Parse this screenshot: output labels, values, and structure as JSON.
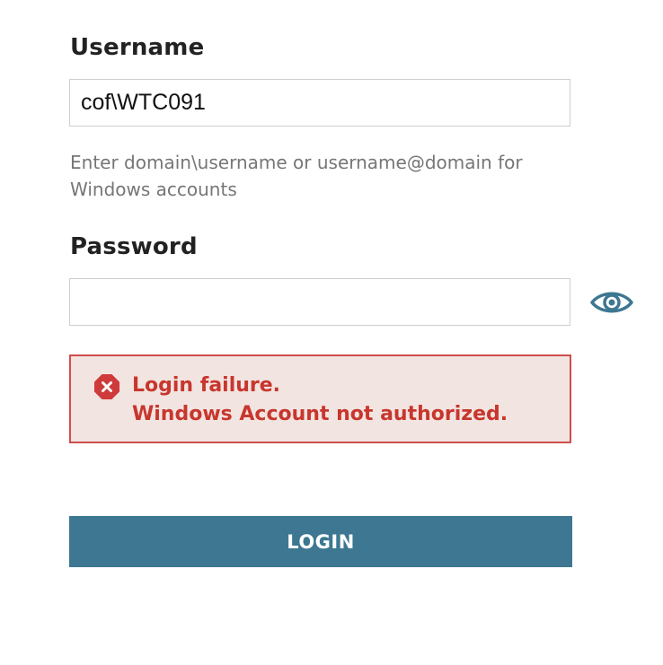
{
  "form": {
    "username_label": "Username",
    "username_value": "cof\\WTC091",
    "username_hint": "Enter domain\\username or username@domain for Windows accounts",
    "password_label": "Password",
    "password_value": "",
    "show_password_icon": "eye-icon"
  },
  "alert": {
    "icon": "error-x-icon",
    "line1": "Login failure.",
    "line2": "Windows Account not authorized."
  },
  "login_button": {
    "label": "LOGIN"
  },
  "colors": {
    "accent": "#3d7791",
    "error_text": "#c8362d",
    "error_background": "#f2e4e1",
    "error_border": "#cf4e4b"
  }
}
